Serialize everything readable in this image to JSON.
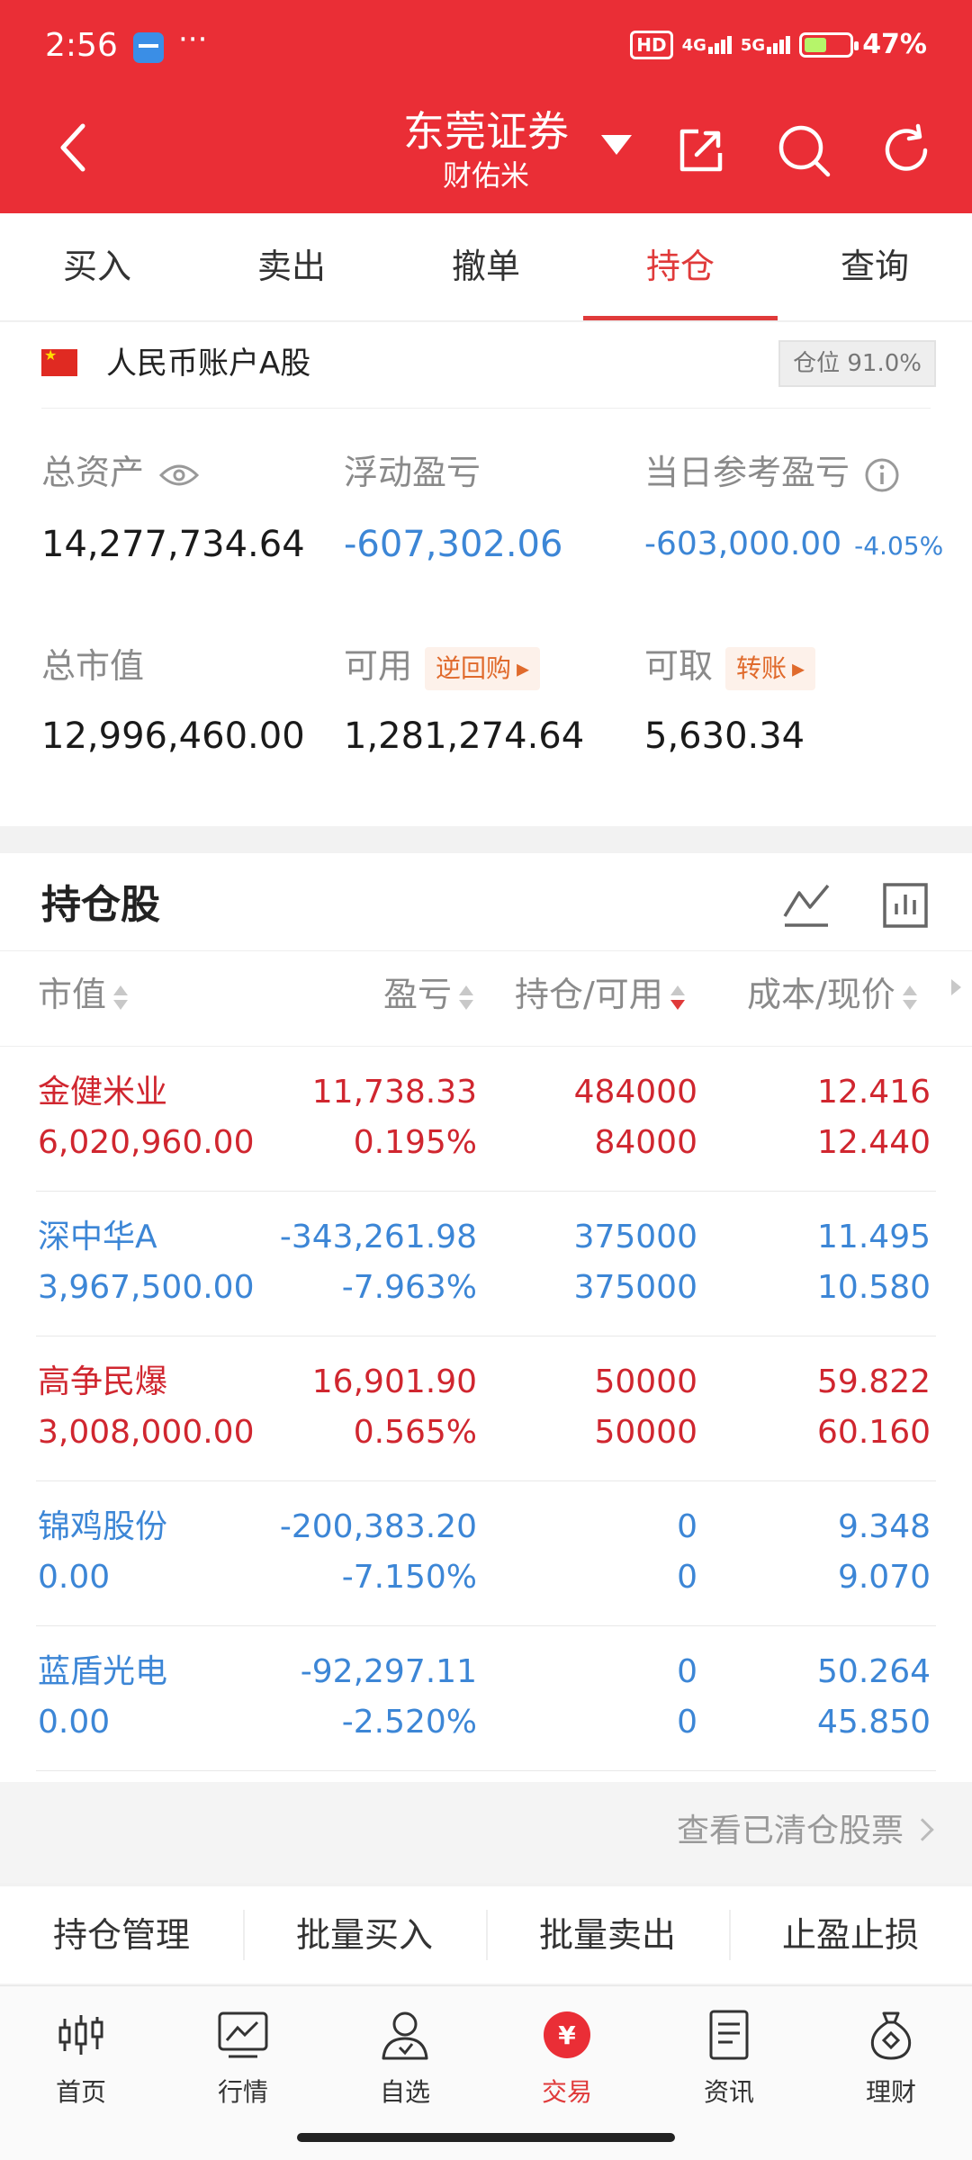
{
  "status": {
    "time": "2:56",
    "dots": "···",
    "hd": "HD",
    "net1": "4G",
    "net2": "5G",
    "battery": "47%"
  },
  "header": {
    "title": "东莞证券",
    "subtitle": "财佑米"
  },
  "tabs": [
    "买入",
    "卖出",
    "撤单",
    "持仓",
    "查询"
  ],
  "account": {
    "name": "人民币账户A股",
    "position_label": "仓位 91.0%",
    "total_assets_label": "总资产",
    "total_assets": "14,277,734.64",
    "floating_pl_label": "浮动盈亏",
    "floating_pl": "-607,302.06",
    "daily_pl_label": "当日参考盈亏",
    "daily_pl": "-603,000.00",
    "daily_pl_pct": "-4.05%",
    "market_value_label": "总市值",
    "market_value": "12,996,460.00",
    "available_label": "可用",
    "available": "1,281,274.64",
    "reverse_repo": "逆回购",
    "withdrawable_label": "可取",
    "withdrawable": "5,630.34",
    "transfer": "转账"
  },
  "holdings": {
    "title": "持仓股",
    "headers": [
      "市值",
      "盈亏",
      "持仓/可用",
      "成本/现价"
    ],
    "rows": [
      {
        "name": "金健米业",
        "mv": "6,020,960.00",
        "pl": "11,738.33",
        "plpct": "0.195%",
        "hold": "484000",
        "avail": "84000",
        "cost": "12.416",
        "price": "12.440"
      },
      {
        "name": "深中华A",
        "mv": "3,967,500.00",
        "pl": "-343,261.98",
        "plpct": "-7.963%",
        "hold": "375000",
        "avail": "375000",
        "cost": "11.495",
        "price": "10.580"
      },
      {
        "name": "高争民爆",
        "mv": "3,008,000.00",
        "pl": "16,901.90",
        "plpct": "0.565%",
        "hold": "50000",
        "avail": "50000",
        "cost": "59.822",
        "price": "60.160"
      },
      {
        "name": "锦鸡股份",
        "mv": "0.00",
        "pl": "-200,383.20",
        "plpct": "-7.150%",
        "hold": "0",
        "avail": "0",
        "cost": "9.348",
        "price": "9.070"
      },
      {
        "name": "蓝盾光电",
        "mv": "0.00",
        "pl": "-92,297.11",
        "plpct": "-2.520%",
        "hold": "0",
        "avail": "0",
        "cost": "50.264",
        "price": "45.850"
      }
    ]
  },
  "cleared_link": "查看已清仓股票",
  "actions": [
    "持仓管理",
    "批量买入",
    "批量卖出",
    "止盈止损"
  ],
  "bottom_nav": [
    "首页",
    "行情",
    "自选",
    "交易",
    "资讯",
    "理财"
  ],
  "colors": {
    "brand": "#ea2e36",
    "up": "#d0262f",
    "down": "#3c86d6"
  }
}
